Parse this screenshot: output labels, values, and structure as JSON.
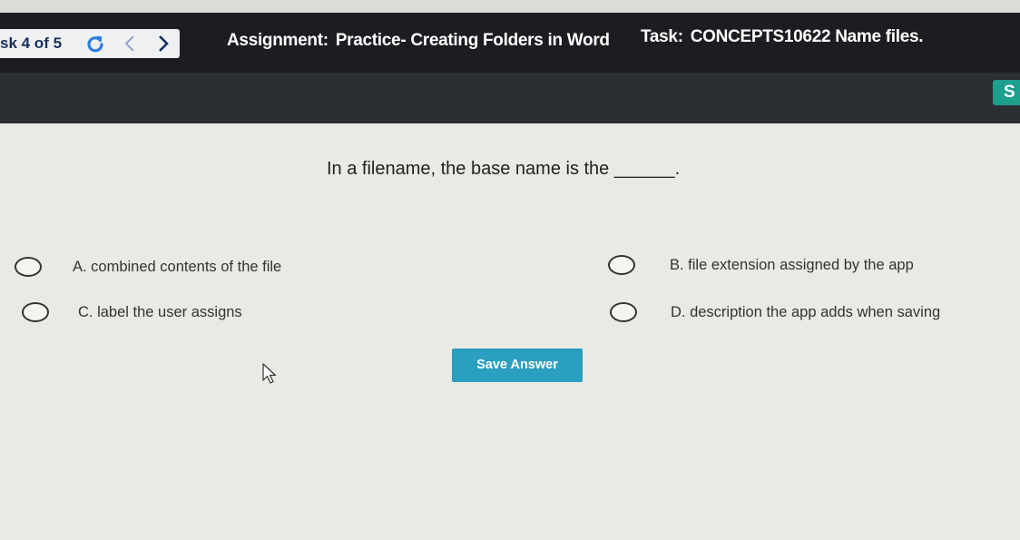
{
  "header": {
    "task_counter": "sk 4 of 5",
    "assignment_label": "Assignment:",
    "assignment_value": "Practice- Creating Folders in Word",
    "task_label": "Task:",
    "task_value": "CONCEPTS10622 Name files.",
    "side_button_label": "S"
  },
  "question": {
    "text": "In a filename, the base name is the ______."
  },
  "options": [
    {
      "label": "A. combined contents of the file"
    },
    {
      "label": "B. file extension assigned by the app"
    },
    {
      "label": "C. label the user assigns"
    },
    {
      "label": "D. description the app adds when saving"
    }
  ],
  "actions": {
    "save_label": "Save Answer"
  },
  "icons": {
    "refresh": "refresh-icon",
    "previous": "chevron-left-icon",
    "next": "chevron-right-icon",
    "pointer": "mouse-pointer-icon"
  },
  "colors": {
    "header_bg": "#1b1d20",
    "counter_text": "#1a2f5e",
    "accent_teal": "#1d9f8e",
    "save_button_bg": "#2a9fbf",
    "refresh_icon": "#2f7de0"
  }
}
